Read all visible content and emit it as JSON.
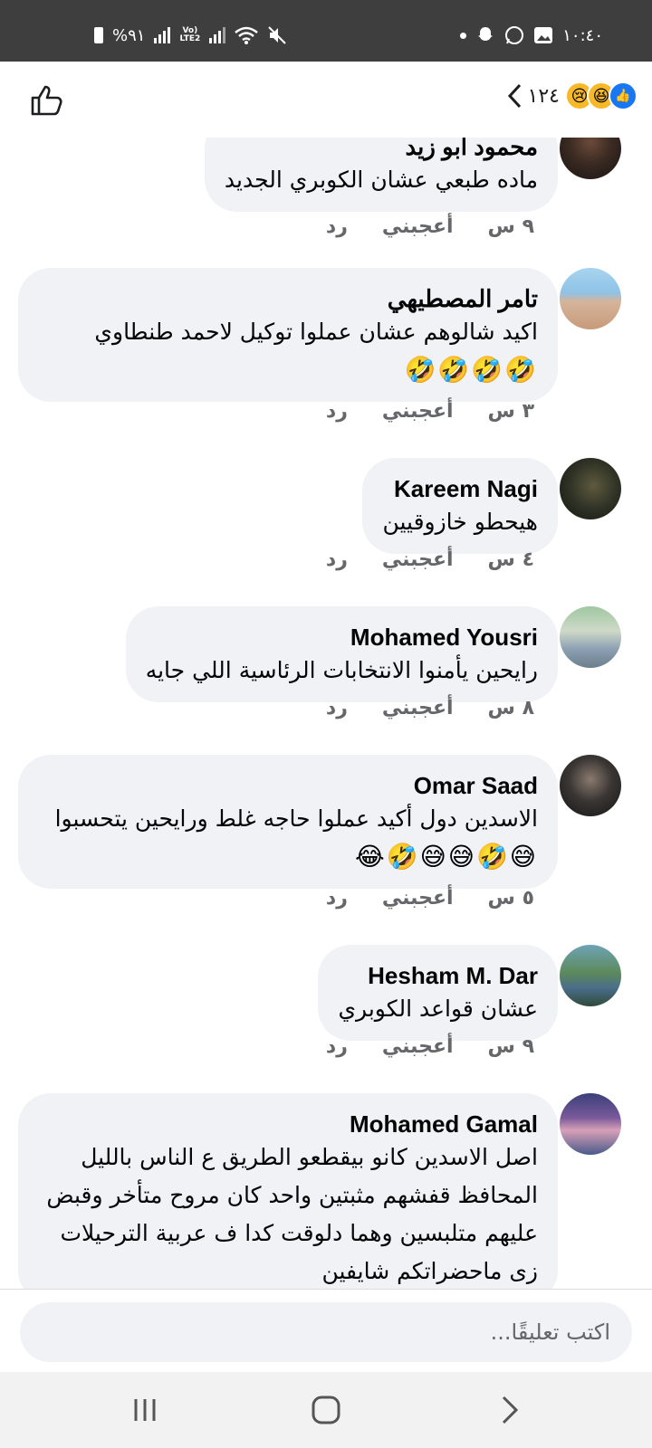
{
  "status_bar": {
    "time": "١٠:٤٠",
    "battery": "%٩١",
    "network": "LTE2"
  },
  "header": {
    "reaction_count": "١٢٤",
    "reaction_icons": [
      "sad-emoji",
      "haha-emoji",
      "like-reaction"
    ]
  },
  "comments": [
    {
      "name": "محمود ابو زيد",
      "text": "ماده طبعي عشان الكوبري الجديد",
      "emojis": "",
      "time": "٩ س",
      "like": "أعجبني",
      "reply": "رد"
    },
    {
      "name": "تامر المصطيهي",
      "text": "اكيد شالوهم عشان عملوا توكيل لاحمد طنطاوي",
      "emojis": "🤣🤣🤣🤣",
      "time": "٣ س",
      "like": "أعجبني",
      "reply": "رد"
    },
    {
      "name": "Kareem Nagi",
      "text": "هيحطو خازوقيين",
      "emojis": "",
      "time": "٤ س",
      "like": "أعجبني",
      "reply": "رد"
    },
    {
      "name": "Mohamed Yousri",
      "text": "رايحين يأمنوا الانتخابات الرئاسية اللي جايه",
      "emojis": "",
      "time": "٨ س",
      "like": "أعجبني",
      "reply": "رد"
    },
    {
      "name": "Omar Saad",
      "text": "الاسدين دول أكيد عملوا حاجه غلط ورايحين يتحسبوا",
      "emojis": "😅🤣😅😅🤣😂",
      "time": "٥ س",
      "like": "أعجبني",
      "reply": "رد"
    },
    {
      "name": "Hesham M. Dar",
      "text": "عشان قواعد الكوبري",
      "emojis": "",
      "time": "٩ س",
      "like": "أعجبني",
      "reply": "رد"
    },
    {
      "name": "Mohamed Gamal",
      "text": "اصل الاسدين كانو بيقطعو الطريق ع الناس بالليل المحافظ قفشهم مثبتين واحد كان مروح متأخر وقبض عليهم متلبسين وهما دلوقت كدا ف عربية الترحيلات زى ماحضراتكم شايفين",
      "emojis": "",
      "time": "",
      "like": "",
      "reply": ""
    }
  ],
  "composer": {
    "placeholder": "اكتب تعليقًا..."
  },
  "colors": {
    "bubble": "#f0f2f5",
    "statusbar": "#3e3e3e",
    "like_blue": "#1877f2",
    "meta_grey": "#65676b"
  }
}
